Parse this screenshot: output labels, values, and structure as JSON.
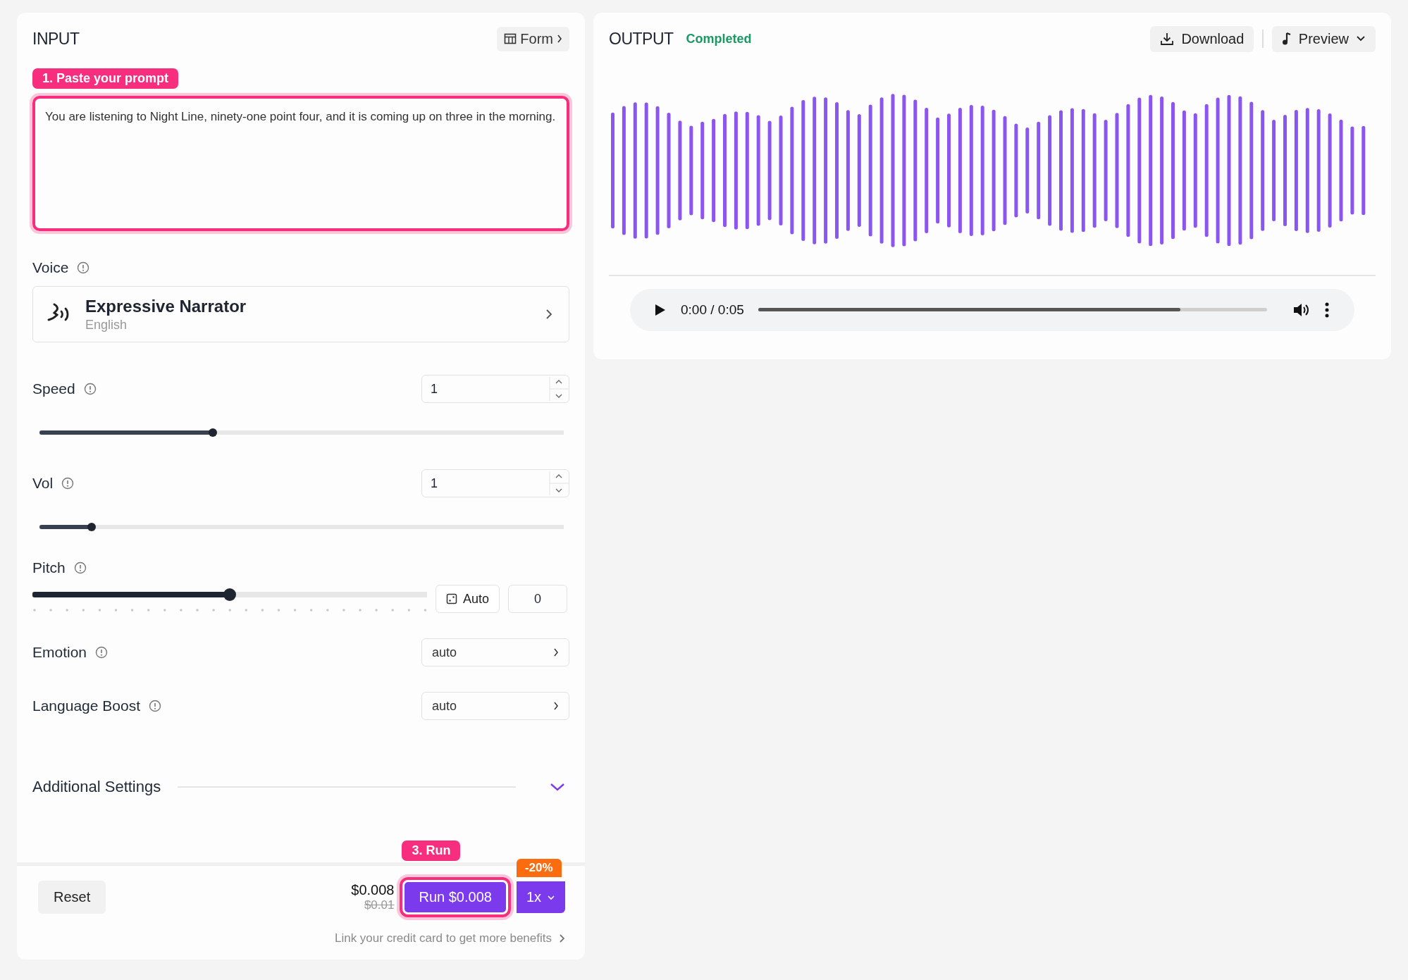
{
  "input": {
    "title": "INPUT",
    "form_button": "Form",
    "step_badge": "1. Paste your prompt",
    "prompt": "You are listening to Night Line, ninety-one point four, and it is coming up on three in the morning.",
    "fields": [
      {
        "kind": "voice",
        "label": "Voice",
        "name": "Expressive Narrator",
        "language": "English"
      },
      {
        "kind": "slider",
        "label": "Speed",
        "value": "1",
        "level": 0.33
      },
      {
        "kind": "slider",
        "label": "Vol",
        "value": "1",
        "level": 0.1
      },
      {
        "kind": "pitch",
        "label": "Pitch",
        "auto_button": "Auto",
        "value": "0",
        "level": 0.5
      },
      {
        "kind": "select",
        "label": "Emotion",
        "value": "auto"
      },
      {
        "kind": "select",
        "label": "Language Boost",
        "value": "auto"
      }
    ],
    "additional_settings": {
      "label": "Additional Settings",
      "expanded": false
    },
    "footer": {
      "reset": "Reset",
      "price": "$0.008",
      "old_price": "$0.01",
      "step_badge": "3. Run",
      "run_button": "Run $0.008",
      "discount": "-20%",
      "multiplier": "1x",
      "credit_link": "Link your credit card to get more benefits"
    }
  },
  "output": {
    "title": "OUTPUT",
    "status": "Completed",
    "download": "Download",
    "preview": "Preview",
    "player": {
      "time": "0:00 / 0:05",
      "level": 0.83
    }
  }
}
